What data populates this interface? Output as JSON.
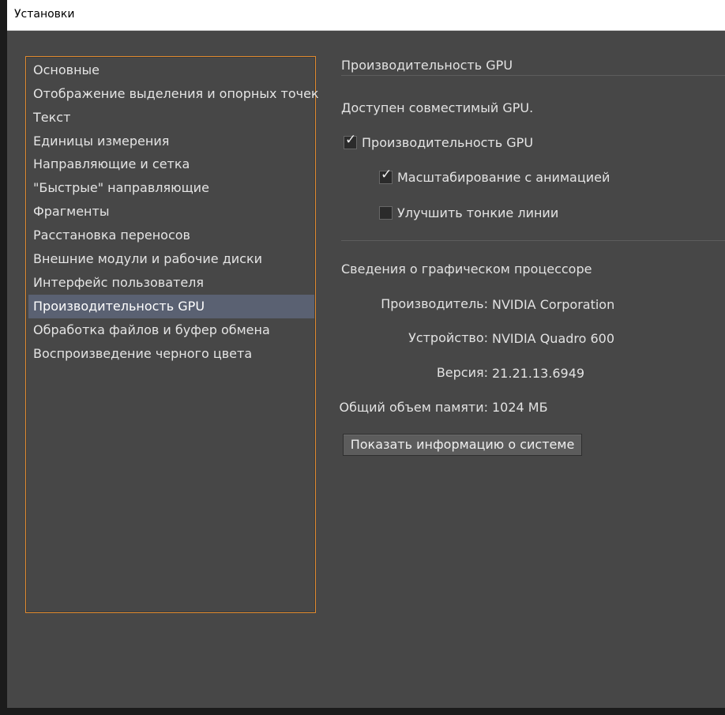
{
  "window": {
    "title": "Установки"
  },
  "sidebar": {
    "items": [
      {
        "label": "Основные"
      },
      {
        "label": "Отображение выделения и опорных точек"
      },
      {
        "label": "Текст"
      },
      {
        "label": "Единицы измерения"
      },
      {
        "label": "Направляющие и сетка"
      },
      {
        "label": "\"Быстрые\" направляющие"
      },
      {
        "label": "Фрагменты"
      },
      {
        "label": "Расстановка переносов"
      },
      {
        "label": "Внешние модули и рабочие диски"
      },
      {
        "label": "Интерфейс пользователя"
      },
      {
        "label": "Производительность GPU"
      },
      {
        "label": "Обработка файлов и буфер обмена"
      },
      {
        "label": "Воспроизведение черного цвета"
      }
    ],
    "selected_index": 10
  },
  "gpu": {
    "section_title": "Производительность GPU",
    "status_text": "Доступен совместимый GPU.",
    "checkboxes": [
      {
        "label": "Производительность GPU",
        "checked": true
      },
      {
        "label": "Масштабирование с анимацией",
        "checked": true
      },
      {
        "label": "Улучшить тонкие линии",
        "checked": false
      }
    ]
  },
  "gpu_info": {
    "section_title": "Сведения о графическом процессоре",
    "rows": [
      {
        "label": "Производитель:",
        "value": "NVIDIA Corporation"
      },
      {
        "label": "Устройство:",
        "value": "NVIDIA Quadro 600"
      },
      {
        "label": "Версия:",
        "value": "21.21.13.6949"
      },
      {
        "label": "Общий объем памяти:",
        "value": "1024 МБ"
      }
    ],
    "button_label": "Показать информацию о системе"
  },
  "colors": {
    "accent_border": "#e08a2f",
    "selected_bg": "#5a6172",
    "panel_bg": "#474747"
  }
}
